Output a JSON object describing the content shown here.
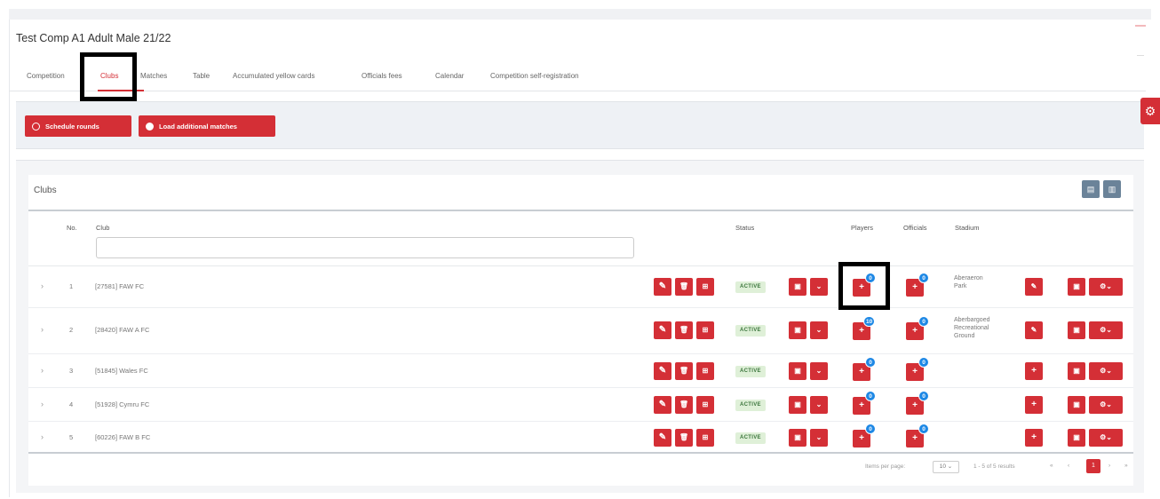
{
  "page": {
    "title": "Test Comp A1 Adult Male 21/22"
  },
  "tabs": [
    {
      "label": "Competition"
    },
    {
      "label": "Clubs",
      "active": true
    },
    {
      "label": "Matches"
    },
    {
      "label": "Table"
    },
    {
      "label": "Accumulated yellow cards"
    },
    {
      "label": "Officials fees"
    },
    {
      "label": "Calendar"
    },
    {
      "label": "Competition self-registration"
    }
  ],
  "actions": {
    "schedule_rounds": "Schedule rounds",
    "load_additional_matches": "Load additional matches"
  },
  "panel": {
    "title": "Clubs",
    "columns": {
      "no": "No.",
      "club": "Club",
      "status": "Status",
      "players": "Players",
      "officials": "Officials",
      "stadium": "Stadium"
    },
    "filter_value": ""
  },
  "rows": [
    {
      "no": "1",
      "club": "[27581] FAW FC",
      "status": "ACTIVE",
      "players_count": "0",
      "officials_count": "0",
      "stadium": "Aberaeron\nPark"
    },
    {
      "no": "2",
      "club": "[28420] FAW A FC",
      "status": "ACTIVE",
      "players_count": "10",
      "officials_count": "0",
      "stadium": "Aberbargoed\nRecreational\nGround"
    },
    {
      "no": "3",
      "club": "[51845] Wales FC",
      "status": "ACTIVE",
      "players_count": "0",
      "officials_count": "0",
      "stadium": ""
    },
    {
      "no": "4",
      "club": "[51928] Cymru FC",
      "status": "ACTIVE",
      "players_count": "0",
      "officials_count": "0",
      "stadium": ""
    },
    {
      "no": "5",
      "club": "[60226] FAW B FC",
      "status": "ACTIVE",
      "players_count": "0",
      "officials_count": "0",
      "stadium": ""
    }
  ],
  "pagination": {
    "items_per_page_label": "Items per page:",
    "items_per_page": "10",
    "range": "1 - 5 of 5 results",
    "current_page": "1"
  },
  "colors": {
    "accent": "#d42f36",
    "badge": "#1e88e5",
    "active_bg": "#dff0d8"
  }
}
